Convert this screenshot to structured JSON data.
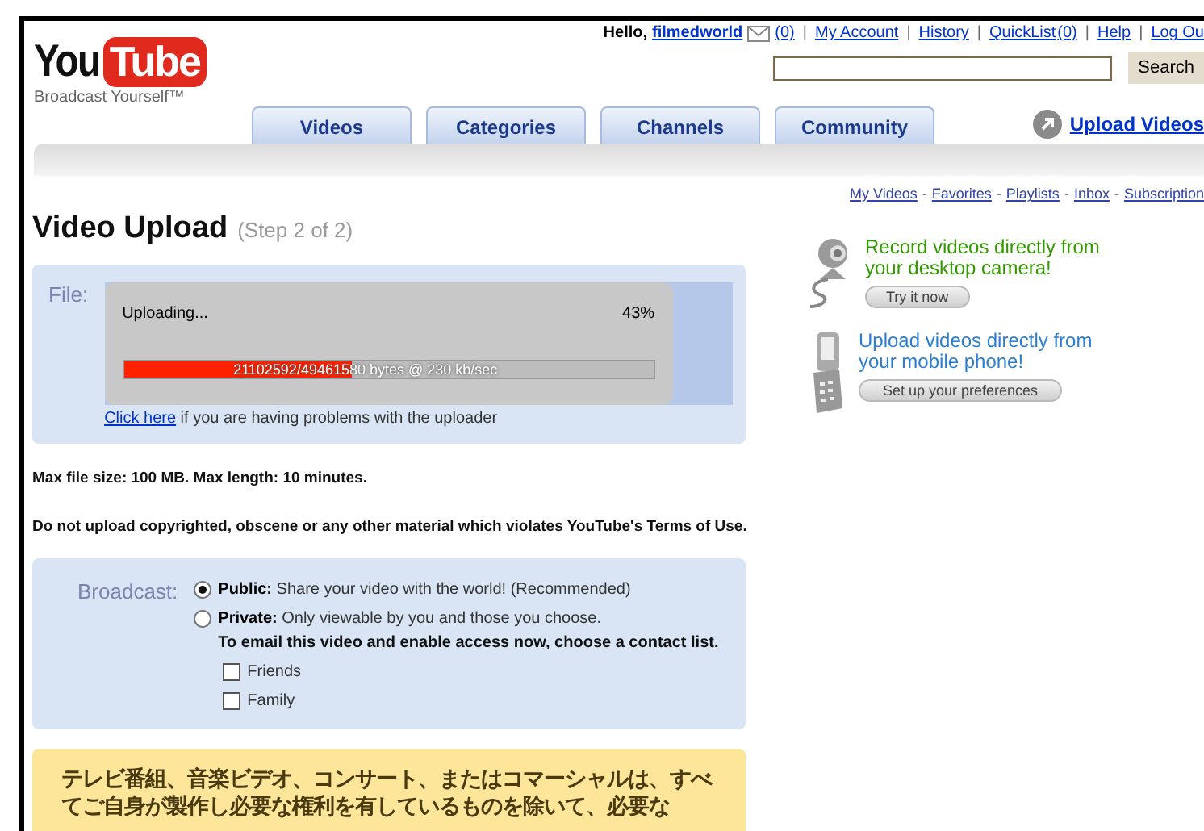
{
  "header": {
    "logo": {
      "word1": "You",
      "word2": "Tube",
      "tagline": "Broadcast Yourself™"
    },
    "separator": "|",
    "greeting": "Hello,",
    "username": "filmedworld",
    "links": [
      {
        "label": "(0)",
        "kind": "mail"
      },
      {
        "label": "My Account",
        "kind": "link"
      },
      {
        "label": "History",
        "kind": "link"
      },
      {
        "label": "QuickList",
        "count": "(0)",
        "kind": "link"
      },
      {
        "label": "Help",
        "kind": "link"
      },
      {
        "label": "Log Ou",
        "kind": "link"
      }
    ],
    "search": {
      "button": "Search"
    },
    "tabs": [
      {
        "label": "Videos"
      },
      {
        "label": "Categories"
      },
      {
        "label": "Channels"
      },
      {
        "label": "Community"
      }
    ],
    "upload_link": "Upload Videos"
  },
  "subnav_separator": "-",
  "subnav": [
    "My Videos",
    "Favorites",
    "Playlists",
    "Inbox",
    "Subscription"
  ],
  "title": "Video Upload",
  "step": "(Step 2 of 2)",
  "upload": {
    "label": "File:",
    "status": "Uploading...",
    "percent": "43%",
    "level": 0.43,
    "bytes": "21102592/49461580 bytes @ 230 kb/sec",
    "help_link": "Click here",
    "help_text": " if you are having problems with the uploader"
  },
  "notes": [
    "Max file size: 100 MB. Max length: 10 minutes.",
    "Do not upload copyrighted, obscene or any other material which violates YouTube's Terms of Use."
  ],
  "broadcast": {
    "label": "Broadcast:",
    "options": [
      {
        "title": "Public:",
        "desc": "Share your video with the world! (Recommended)",
        "selected": true
      },
      {
        "title": "Private:",
        "desc": "Only viewable by you and those you choose.",
        "selected": false
      }
    ],
    "email_note": "To email this video and enable access now, choose a contact list.",
    "contacts": [
      {
        "label": "Friends",
        "checked": false
      },
      {
        "label": "Family",
        "checked": false
      }
    ]
  },
  "notice": "テレビ番組、音楽ビデオ、コンサート、またはコマーシャルは、すべてご自身が製作し必要な権利を有しているものを除いて、必要な",
  "promos": [
    {
      "kind": "camera",
      "title": "Record videos directly from your desktop camera!",
      "button": "Try it now",
      "color": "#339900"
    },
    {
      "kind": "phone",
      "title": "Upload videos directly from your mobile phone!",
      "button": "Set up your preferences",
      "color": "#2a7fd4"
    }
  ]
}
